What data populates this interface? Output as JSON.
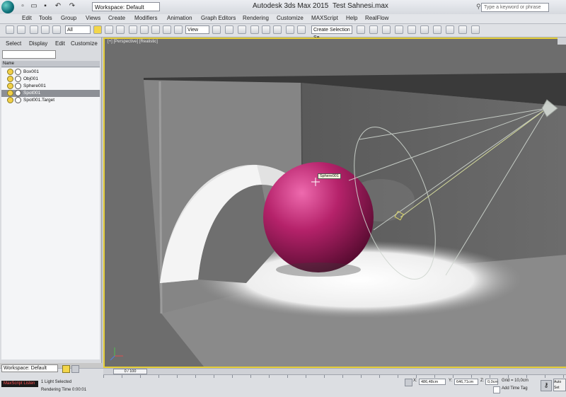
{
  "titlebar": {
    "workspace": "Workspace: Default",
    "app_title": "Autodesk 3ds Max  2015",
    "file_title": "Test Sahnesi.max",
    "search_placeholder": "Type a keyword or phrase"
  },
  "menu": [
    "Edit",
    "Tools",
    "Group",
    "Views",
    "Create",
    "Modifiers",
    "Animation",
    "Graph Editors",
    "Rendering",
    "Customize",
    "MAXScript",
    "Help",
    "RealFlow"
  ],
  "toolbar": {
    "filter_value": "All",
    "view_value": "View",
    "selection_set": "Create Selection Se"
  },
  "left_panel": {
    "tabs": [
      "Select",
      "Display",
      "Edit",
      "Customize"
    ],
    "header": "Name",
    "items": [
      "Box001",
      "Obj001",
      "Sphere001",
      "Spot001",
      "Spot001.Target"
    ],
    "selected_index": 3,
    "workspace": "Workspace: Default"
  },
  "viewport": {
    "label": "[+] [Perspective] [Realistic]",
    "tooltip": "Sphere001",
    "sphere_color": "#b5226a",
    "frame_color": "#e6cf38"
  },
  "timeline": {
    "slider": "0 / 100"
  },
  "status": {
    "maxscript": "MaxScript Listen",
    "selection": "1 Light Selected",
    "render_time": "Rendering Time 0:00:01",
    "x_label": "X:",
    "x_value": "486,48cm",
    "y_label": "Y:",
    "y_value": "646,71cm",
    "z_label": "Z:",
    "z_value": "0,0cm",
    "grid": "Grid = 10,0cm",
    "add_time_tag": "Add Time Tag",
    "set_key": "Auto Set"
  }
}
